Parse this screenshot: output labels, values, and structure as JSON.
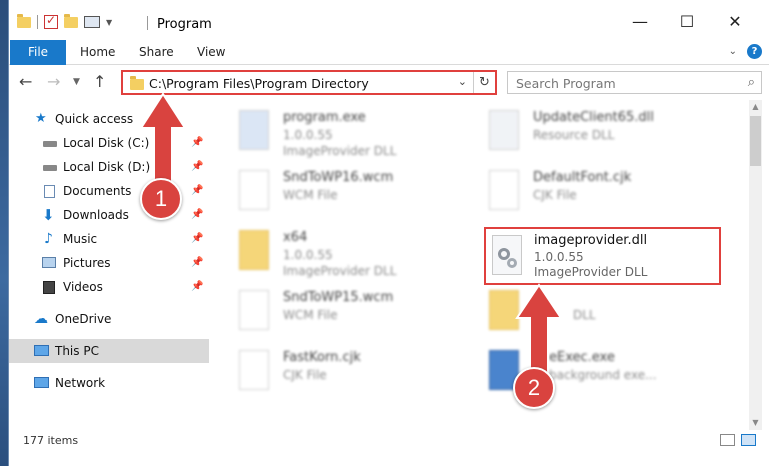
{
  "window": {
    "title": "Program",
    "controls": {
      "minimize": "—",
      "maximize": "☐",
      "close": "✕"
    }
  },
  "ribbon": {
    "file": "File",
    "home": "Home",
    "share": "Share",
    "view": "View",
    "help": "?"
  },
  "navigation": {
    "address": "C:\\Program Files\\Program Directory",
    "search_placeholder": "Search Program"
  },
  "sidebar": {
    "quick_access": "Quick access",
    "items": [
      {
        "label": "Local Disk (C:)"
      },
      {
        "label": "Local Disk (D:)"
      },
      {
        "label": "Documents"
      },
      {
        "label": "Downloads"
      },
      {
        "label": "Music"
      },
      {
        "label": "Pictures"
      },
      {
        "label": "Videos"
      }
    ],
    "onedrive": "OneDrive",
    "this_pc": "This PC",
    "network": "Network"
  },
  "files": [
    {
      "name": "program.exe",
      "line2": "1.0.0.55",
      "line3": "ImageProvider DLL"
    },
    {
      "name": "UpdateClient65.dll",
      "line2": "Resource DLL",
      "line3": ""
    },
    {
      "name": "SndToWP16.wcm",
      "line2": "WCM File",
      "line3": ""
    },
    {
      "name": "DefaultFont.cjk",
      "line2": "CJK File",
      "line3": ""
    },
    {
      "name": "x64",
      "line2": "1.0.0.55",
      "line3": "ImageProvider DLL"
    },
    {
      "name": "SndToWP15.wcm",
      "line2": "WCM File",
      "line3": ""
    },
    {
      "name": "FastKorn.cjk",
      "line2": "CJK File",
      "line3": ""
    },
    {
      "name": "eExec.exe",
      "line2": "background exe...",
      "line3": ""
    },
    {
      "name": "DLL",
      "line2": "",
      "line3": ""
    }
  ],
  "highlighted_file": {
    "name": "imageprovider.dll",
    "version": "1.0.0.55",
    "description": "ImageProvider DLL"
  },
  "status": {
    "item_count": "177 items"
  },
  "annotations": {
    "step1": "1",
    "step2": "2",
    "color": "#d9433f"
  }
}
